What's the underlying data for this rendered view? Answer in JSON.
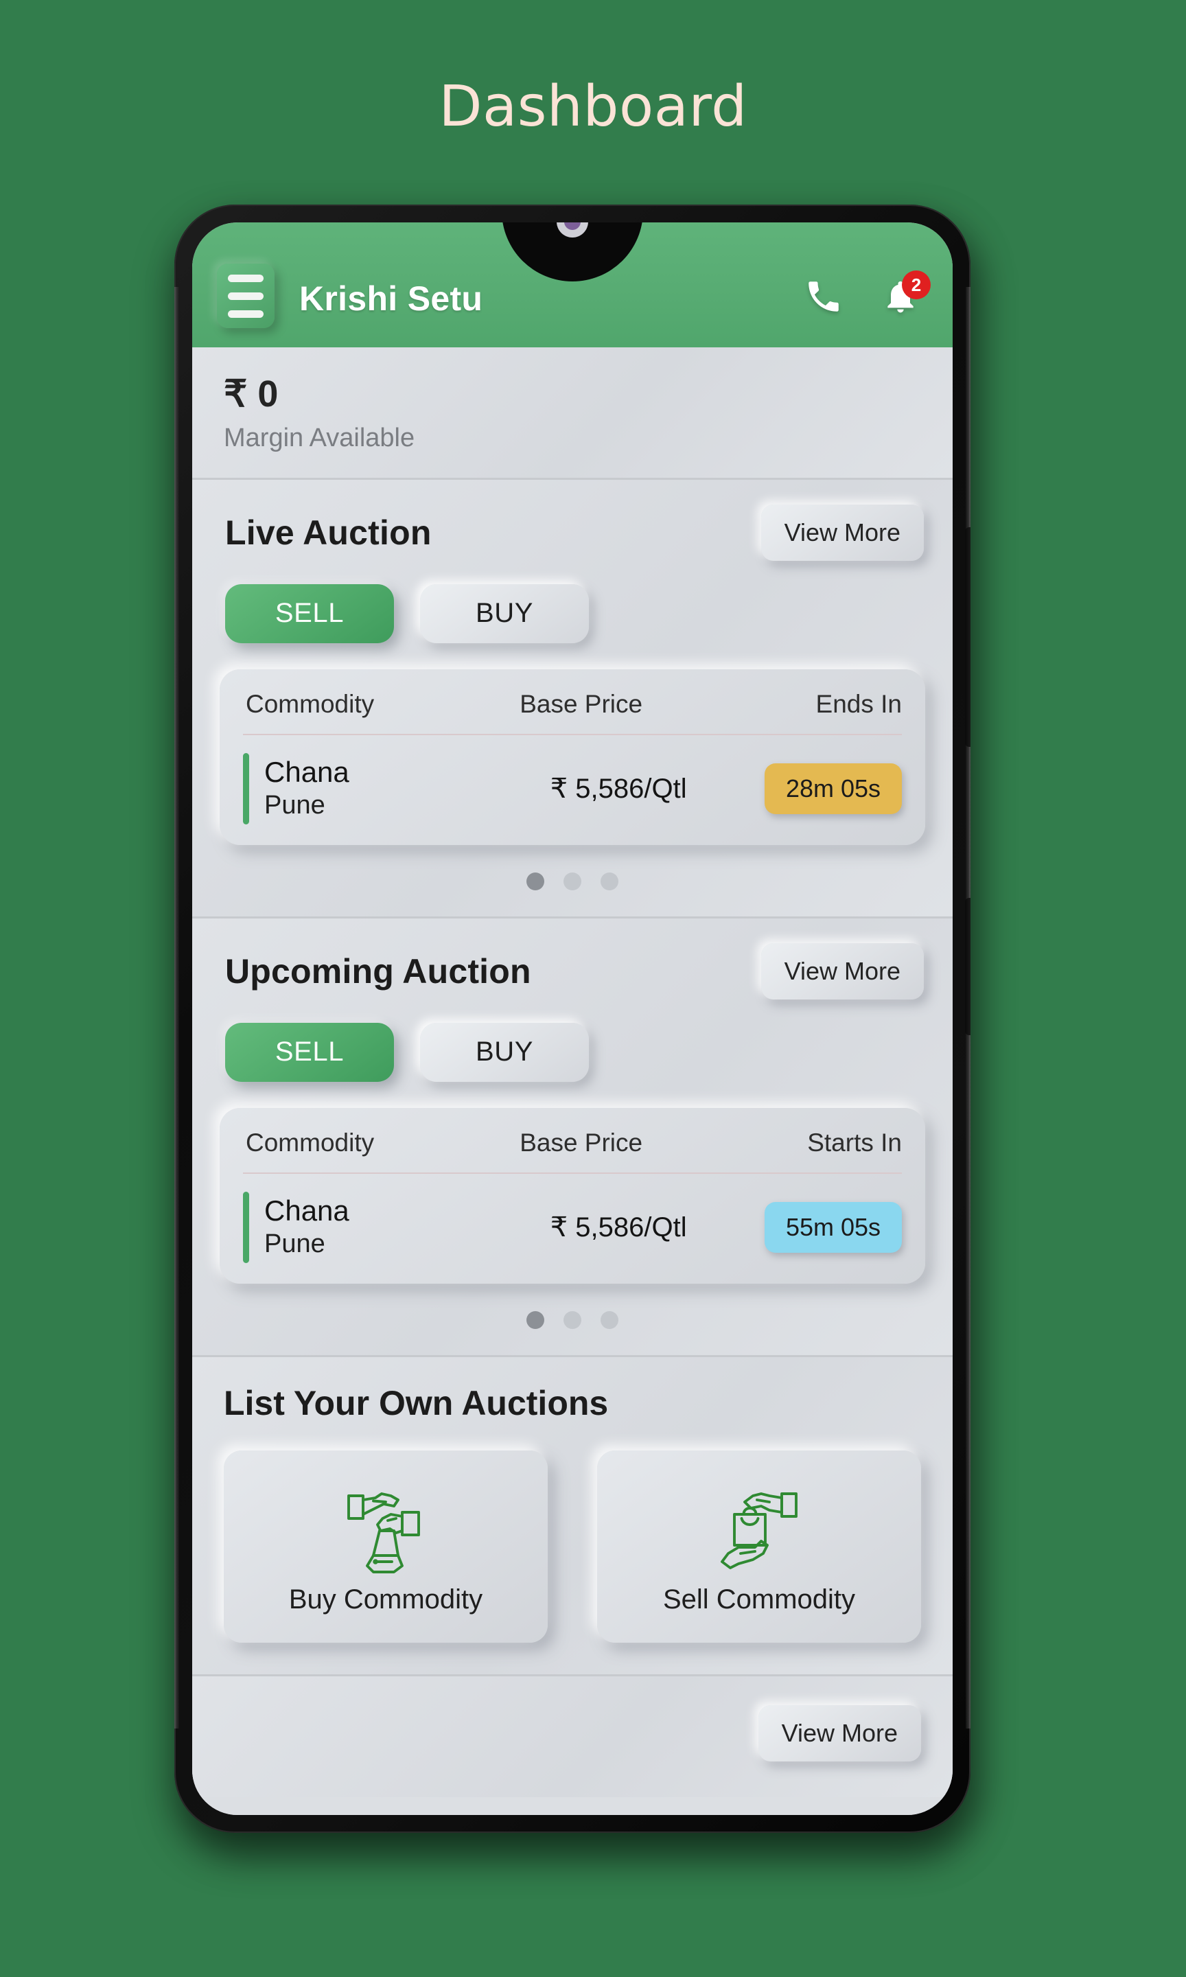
{
  "page": {
    "title": "Dashboard",
    "background_color": "#327d4c",
    "title_color": "#fbe3d6"
  },
  "appbar": {
    "title": "Krishi Setu",
    "menu_icon": "hamburger-menu-icon",
    "phone_icon": "phone-icon",
    "notifications_icon": "bell-icon",
    "notification_count": "2",
    "accent_color": "#57ab72",
    "badge_color": "#e02020"
  },
  "margin": {
    "amount": "₹ 0",
    "label": "Margin Available"
  },
  "live_auction": {
    "title": "Live Auction",
    "view_more_label": "View More",
    "tabs": [
      {
        "label": "SELL",
        "active": true
      },
      {
        "label": "BUY",
        "active": false
      }
    ],
    "columns": {
      "commodity": "Commodity",
      "base_price": "Base Price",
      "time": "Ends In"
    },
    "row": {
      "commodity": "Chana",
      "location": "Pune",
      "base_price": "₹ 5,586/Qtl",
      "time": "28m 05s",
      "chip_color": "#e4b951",
      "accent_color": "#49a766"
    },
    "pagination": {
      "total": 3,
      "active_index": 0
    }
  },
  "upcoming_auction": {
    "title": "Upcoming Auction",
    "view_more_label": "View More",
    "tabs": [
      {
        "label": "SELL",
        "active": true
      },
      {
        "label": "BUY",
        "active": false
      }
    ],
    "columns": {
      "commodity": "Commodity",
      "base_price": "Base Price",
      "time": "Starts In"
    },
    "row": {
      "commodity": "Chana",
      "location": "Pune",
      "base_price": "₹ 5,586/Qtl",
      "time": "55m 05s",
      "chip_color": "#8ad7ef",
      "accent_color": "#49a766"
    },
    "pagination": {
      "total": 3,
      "active_index": 0
    }
  },
  "list_own": {
    "title": "List Your Own Auctions",
    "cards": [
      {
        "label": "Buy Commodity",
        "icon": "hands-exchange-sack-icon",
        "icon_color": "#2f8a32"
      },
      {
        "label": "Sell Commodity",
        "icon": "hands-exchange-bag-icon",
        "icon_color": "#2f8a32"
      }
    ]
  },
  "footer": {
    "view_more_label": "View More"
  }
}
